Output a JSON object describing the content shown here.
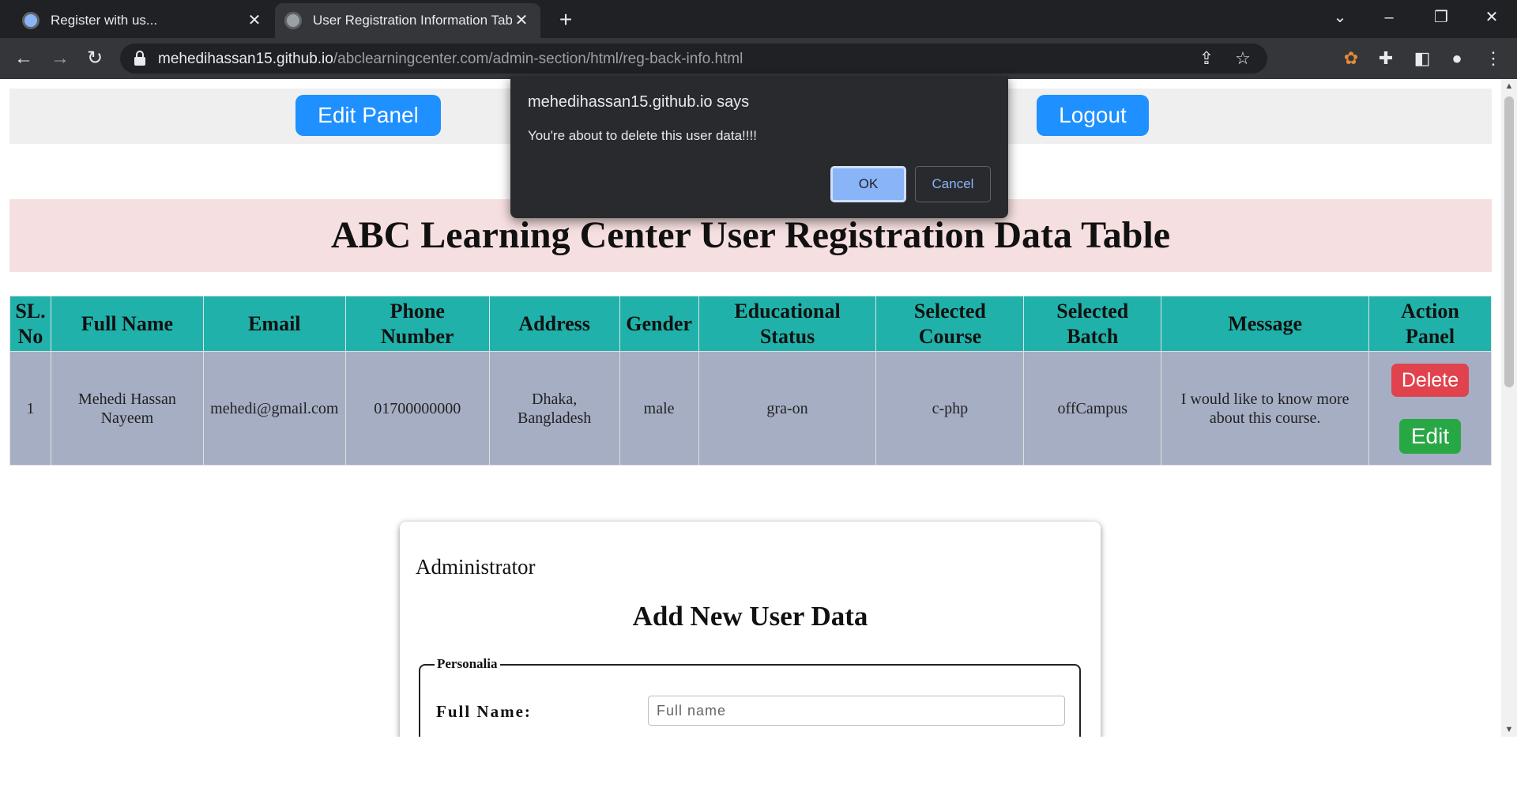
{
  "browser": {
    "tabs": [
      {
        "title": "Register with us...",
        "active": false
      },
      {
        "title": "User Registration Information Tab",
        "active": true
      }
    ],
    "url_host": "mehedihassan15.github.io",
    "url_path": "/abclearningcenter.com/admin-section/html/reg-back-info.html"
  },
  "topnav": {
    "edit_panel_label": "Edit Panel",
    "logout_label": "Logout",
    "accent_color": "#1e90ff"
  },
  "banner": {
    "title": "ABC Learning Center User Registration Data Table"
  },
  "table": {
    "headers": {
      "sl_1": "SL.",
      "sl_2": "No",
      "full_name": "Full Name",
      "email": "Email",
      "phone_1": "Phone",
      "phone_2": "Number",
      "address": "Address",
      "gender": "Gender",
      "edu_1": "Educational",
      "edu_2": "Status",
      "course_1": "Selected",
      "course_2": "Course",
      "batch_1": "Selected",
      "batch_2": "Batch",
      "message": "Message",
      "action_1": "Action",
      "action_2": "Panel"
    },
    "rows": [
      {
        "sl": "1",
        "name_1": "Mehedi Hassan",
        "name_2": "Nayeem",
        "email": "mehedi@gmail.com",
        "phone": "01700000000",
        "address_1": "Dhaka,",
        "address_2": "Bangladesh",
        "gender": "male",
        "education": "gra-on",
        "course": "c-php",
        "batch": "offCampus",
        "message_1": "I would like to know more",
        "message_2": "about this course.",
        "delete_label": "Delete",
        "edit_label": "Edit"
      }
    ],
    "header_color": "#20b2aa",
    "row_color": "#a6aec4"
  },
  "form": {
    "role": "Administrator",
    "title": "Add New User Data",
    "legend": "Personalia",
    "full_name_label": "Full Name:",
    "full_name_placeholder": "Full name"
  },
  "dialog": {
    "title": "mehedihassan15.github.io says",
    "message": "You're about to delete this user data!!!!",
    "ok_label": "OK",
    "cancel_label": "Cancel"
  }
}
